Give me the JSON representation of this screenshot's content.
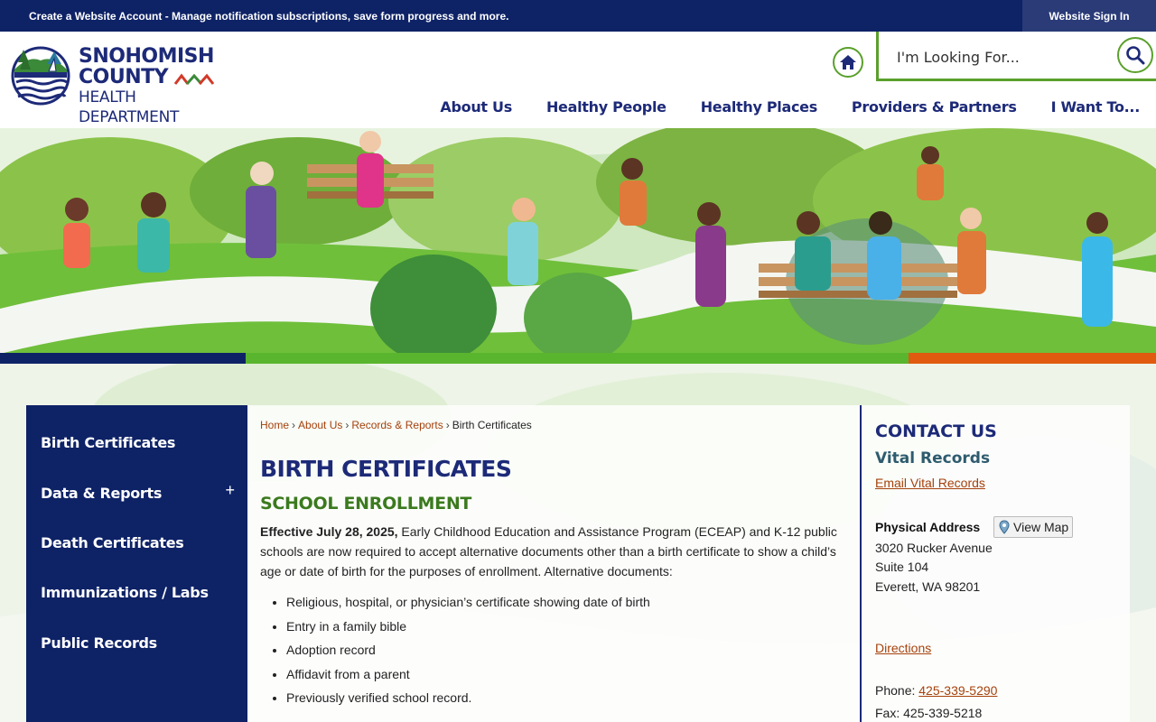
{
  "topbar": {
    "create_account": "Create a Website Account",
    "message": " - Manage notification subscriptions, save form progress and more.",
    "sign_in": "Website Sign In"
  },
  "header": {
    "logo": {
      "line1": "SNOHOMISH",
      "line2": "COUNTY",
      "line3": "HEALTH DEPARTMENT"
    },
    "search_placeholder": "I'm Looking For...",
    "nav": [
      "About Us",
      "Healthy People",
      "Healthy Places",
      "Providers & Partners",
      "I Want To..."
    ]
  },
  "sidebar": {
    "items": [
      {
        "label": "Birth Certificates"
      },
      {
        "label": "Data & Reports",
        "expand": "+"
      },
      {
        "label": "Death Certificates"
      },
      {
        "label": "Immunizations / Labs"
      },
      {
        "label": "Public Records"
      }
    ]
  },
  "breadcrumb": {
    "items": [
      "Home",
      "About Us",
      "Records & Reports"
    ],
    "current": "Birth Certificates",
    "separator": "›"
  },
  "main": {
    "title": "BIRTH CERTIFICATES",
    "subtitle": "SCHOOL ENROLLMENT",
    "para_bold": "Effective July 28, 2025,",
    "para_text": " Early Childhood Education and Assistance Program (ECEAP) and K-12 public schools are now required to accept alternative documents other than a birth certificate to show a child’s age or date of birth for the purposes of enrollment. Alternative documents:",
    "documents": [
      "Religious, hospital, or physician’s certificate showing date of birth",
      "Entry in a family bible",
      "Adoption record",
      "Affidavit from a parent",
      "Previously verified school record."
    ]
  },
  "contact": {
    "title": "CONTACT US",
    "subtitle": "Vital Records",
    "email_link": "Email Vital Records",
    "address_label": "Physical Address",
    "view_map": "View Map",
    "address": [
      "3020 Rucker Avenue",
      "Suite 104",
      "Everett, WA 98201"
    ],
    "directions": "Directions",
    "phone_label": "Phone: ",
    "phone": "425-339-5290",
    "fax": "Fax: 425-339-5218"
  },
  "colors": {
    "navy": "#0e2266",
    "green": "#5ab52e",
    "orange": "#e05b10",
    "link": "#a5410c"
  }
}
